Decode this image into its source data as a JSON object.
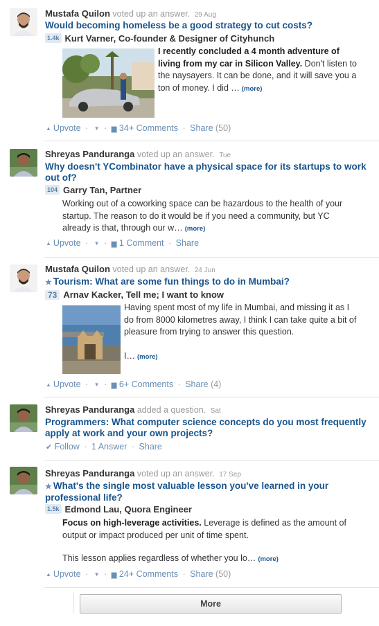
{
  "stories": [
    {
      "user": "Mustafa Quilon",
      "action": "voted up an answer.",
      "when": "29 Aug",
      "question": "Would becoming homeless be a good strategy to cut costs?",
      "starred": false,
      "badge": "1.4k",
      "answerer": "Kurt Varner, Co-founder & Designer of Cityhunch",
      "body_bold": "I recently concluded a 4 month adventure of living from my car in Silicon Valley.",
      "body_text": " Don't listen to the naysayers. It can be done, and it will save you a ton of money. I did …",
      "more": "(more)",
      "upvote": "Upvote",
      "comments": "34+ Comments",
      "share": "Share",
      "share_count": "(50)"
    },
    {
      "user": "Shreyas Panduranga",
      "action": "voted up an answer.",
      "when": "Tue",
      "question": "Why doesn't YCombinator have a physical space for its startups to work out of?",
      "starred": false,
      "badge": "104",
      "answerer": "Garry Tan, Partner",
      "body_text": "Working out of a coworking space can be hazardous to the health of your startup. The reason to do it would be if you need a community, but YC already is that, through our w…",
      "more": "(more)",
      "upvote": "Upvote",
      "comments": "1 Comment",
      "share": "Share"
    },
    {
      "user": "Mustafa Quilon",
      "action": "voted up an answer.",
      "when": "24 Jun",
      "question": "Tourism: What are some fun things to do in Mumbai?",
      "starred": true,
      "badge": "73",
      "answerer": "Arnav Kacker, Tell me; I want to know",
      "body_text": "Having spent most of my life in Mumbai, and missing it as I do from 8000 kilometres away, I think I can take quite a bit of pleasure from trying to answer this question.",
      "body_tail": "I…",
      "more": "(more)",
      "upvote": "Upvote",
      "comments": "6+ Comments",
      "share": "Share",
      "share_count": "(4)"
    },
    {
      "user": "Shreyas Panduranga",
      "action": "added a question.",
      "when": "Sat",
      "question_topic": "Programmers",
      "question": ": What computer science concepts do you most frequently apply at work and your own projects?",
      "follow": "Follow",
      "answers": "1 Answer",
      "share": "Share"
    },
    {
      "user": "Shreyas Panduranga",
      "action": "voted up an answer.",
      "when": "17 Sep",
      "question": "What's the single most valuable lesson you've learned in your professional life?",
      "starred": true,
      "badge": "1.5k",
      "answerer": "Edmond Lau, Quora Engineer",
      "body_bold": "Focus on high-leverage activities.",
      "body_text": "  Leverage is defined as the amount of output or impact produced per unit of time spent.",
      "body_tail": "This lesson applies regardless of whether you lo…",
      "more": "(more)",
      "upvote": "Upvote",
      "comments": "24+ Comments",
      "share": "Share",
      "share_count": "(50)"
    }
  ],
  "more_button": "More",
  "icons": {
    "upvote": "up-triangle-icon",
    "downvote": "down-triangle-icon",
    "comment": "speech-bubble-icon",
    "follow": "checkmark-icon",
    "star": "star-icon"
  },
  "colors": {
    "link": "#19558d",
    "action": "#6a8fb5",
    "meta": "#999999"
  }
}
